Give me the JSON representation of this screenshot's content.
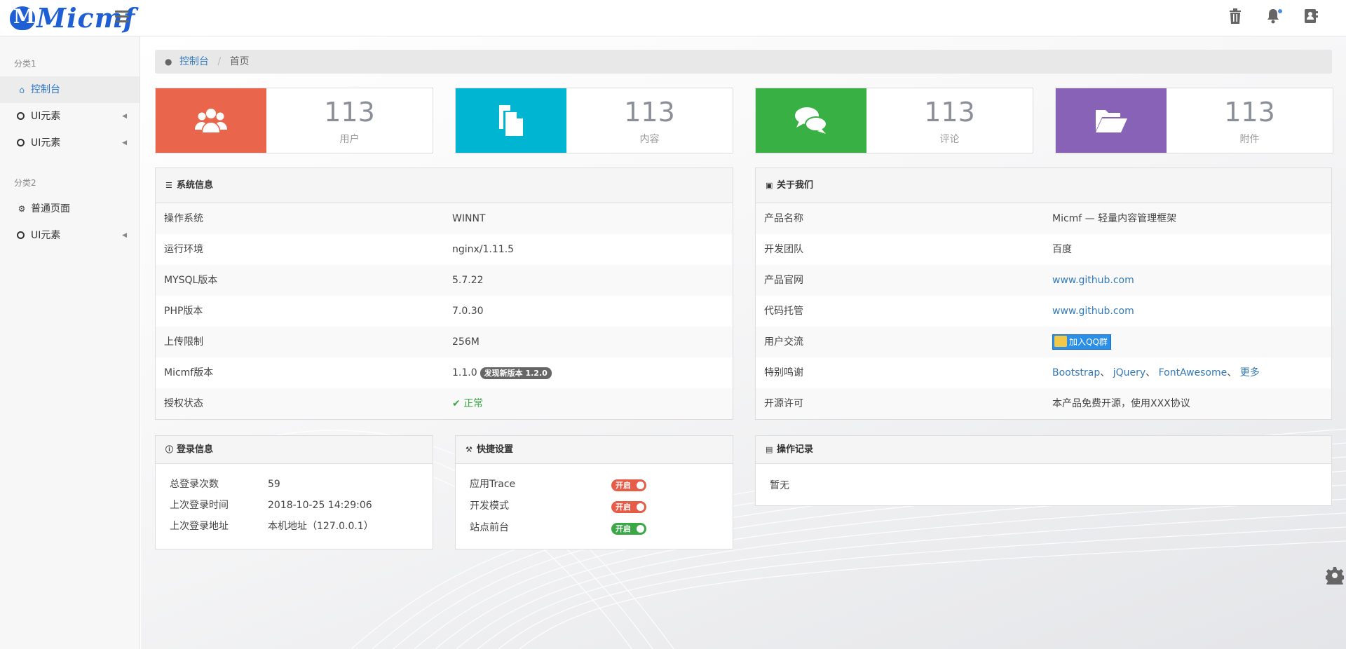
{
  "header": {
    "logo_text": "Micmf"
  },
  "sidebar": {
    "groups": [
      {
        "label": "分类1",
        "items": [
          {
            "label": "控制台",
            "icon": "home-icon",
            "active": true
          },
          {
            "label": "UI元素",
            "icon": "circle-icon"
          },
          {
            "label": "UI元素",
            "icon": "circle-icon"
          }
        ]
      },
      {
        "label": "分类2",
        "items": [
          {
            "label": "普通页面",
            "icon": "gear-icon"
          },
          {
            "label": "UI元素",
            "icon": "circle-icon"
          }
        ]
      }
    ]
  },
  "breadcrumb": {
    "home": "控制台",
    "separator": "/",
    "current": "首页"
  },
  "stats": [
    {
      "value": "113",
      "label": "用户",
      "color": "#e9654b",
      "icon": "users-icon"
    },
    {
      "value": "113",
      "label": "内容",
      "color": "#00b5d1",
      "icon": "documents-icon"
    },
    {
      "value": "113",
      "label": "评论",
      "color": "#39b043",
      "icon": "comments-icon"
    },
    {
      "value": "113",
      "label": "附件",
      "color": "#8762b6",
      "icon": "folder-open-icon"
    }
  ],
  "system_info": {
    "title": "系统信息",
    "rows": [
      {
        "k": "操作系统",
        "v": "WINNT"
      },
      {
        "k": "运行环境",
        "v": "nginx/1.11.5"
      },
      {
        "k": "MYSQL版本",
        "v": "5.7.22"
      },
      {
        "k": "PHP版本",
        "v": "7.0.30"
      },
      {
        "k": "上传限制",
        "v": "256M"
      },
      {
        "k": "Micmf版本",
        "v": "1.1.0",
        "badge": "发现新版本 1.2.0"
      },
      {
        "k": "授权状态",
        "v": "正常"
      }
    ]
  },
  "about": {
    "title": "关于我们",
    "rows": [
      {
        "k": "产品名称",
        "v": "Micmf — 轻量内容管理框架"
      },
      {
        "k": "开发团队",
        "v": "百度"
      },
      {
        "k": "产品官网",
        "v": "www.github.com"
      },
      {
        "k": "代码托管",
        "v": "www.github.com"
      },
      {
        "k": "用户交流",
        "v": "加入QQ群"
      },
      {
        "k": "特别鸣谢",
        "links": [
          "Bootstrap",
          "jQuery",
          "FontAwesome",
          "更多"
        ],
        "sep": "、"
      },
      {
        "k": "开源许可",
        "v": "本产品免费开源，使用XXX协议"
      }
    ]
  },
  "login_info": {
    "title": "登录信息",
    "rows": [
      {
        "k": "总登录次数",
        "v": "59"
      },
      {
        "k": "上次登录时间",
        "v": "2018-10-25 14:29:06"
      },
      {
        "k": "上次登录地址",
        "v": "本机地址（127.0.0.1）"
      }
    ]
  },
  "quick_settings": {
    "title": "快捷设置",
    "rows": [
      {
        "k": "应用Trace",
        "state": "开启",
        "color": "#e75c47"
      },
      {
        "k": "开发模式",
        "state": "开启",
        "color": "#e75c47"
      },
      {
        "k": "站点前台",
        "state": "开启",
        "color": "#3aa845"
      }
    ]
  },
  "operation_log": {
    "title": "操作记录",
    "empty": "暂无"
  }
}
